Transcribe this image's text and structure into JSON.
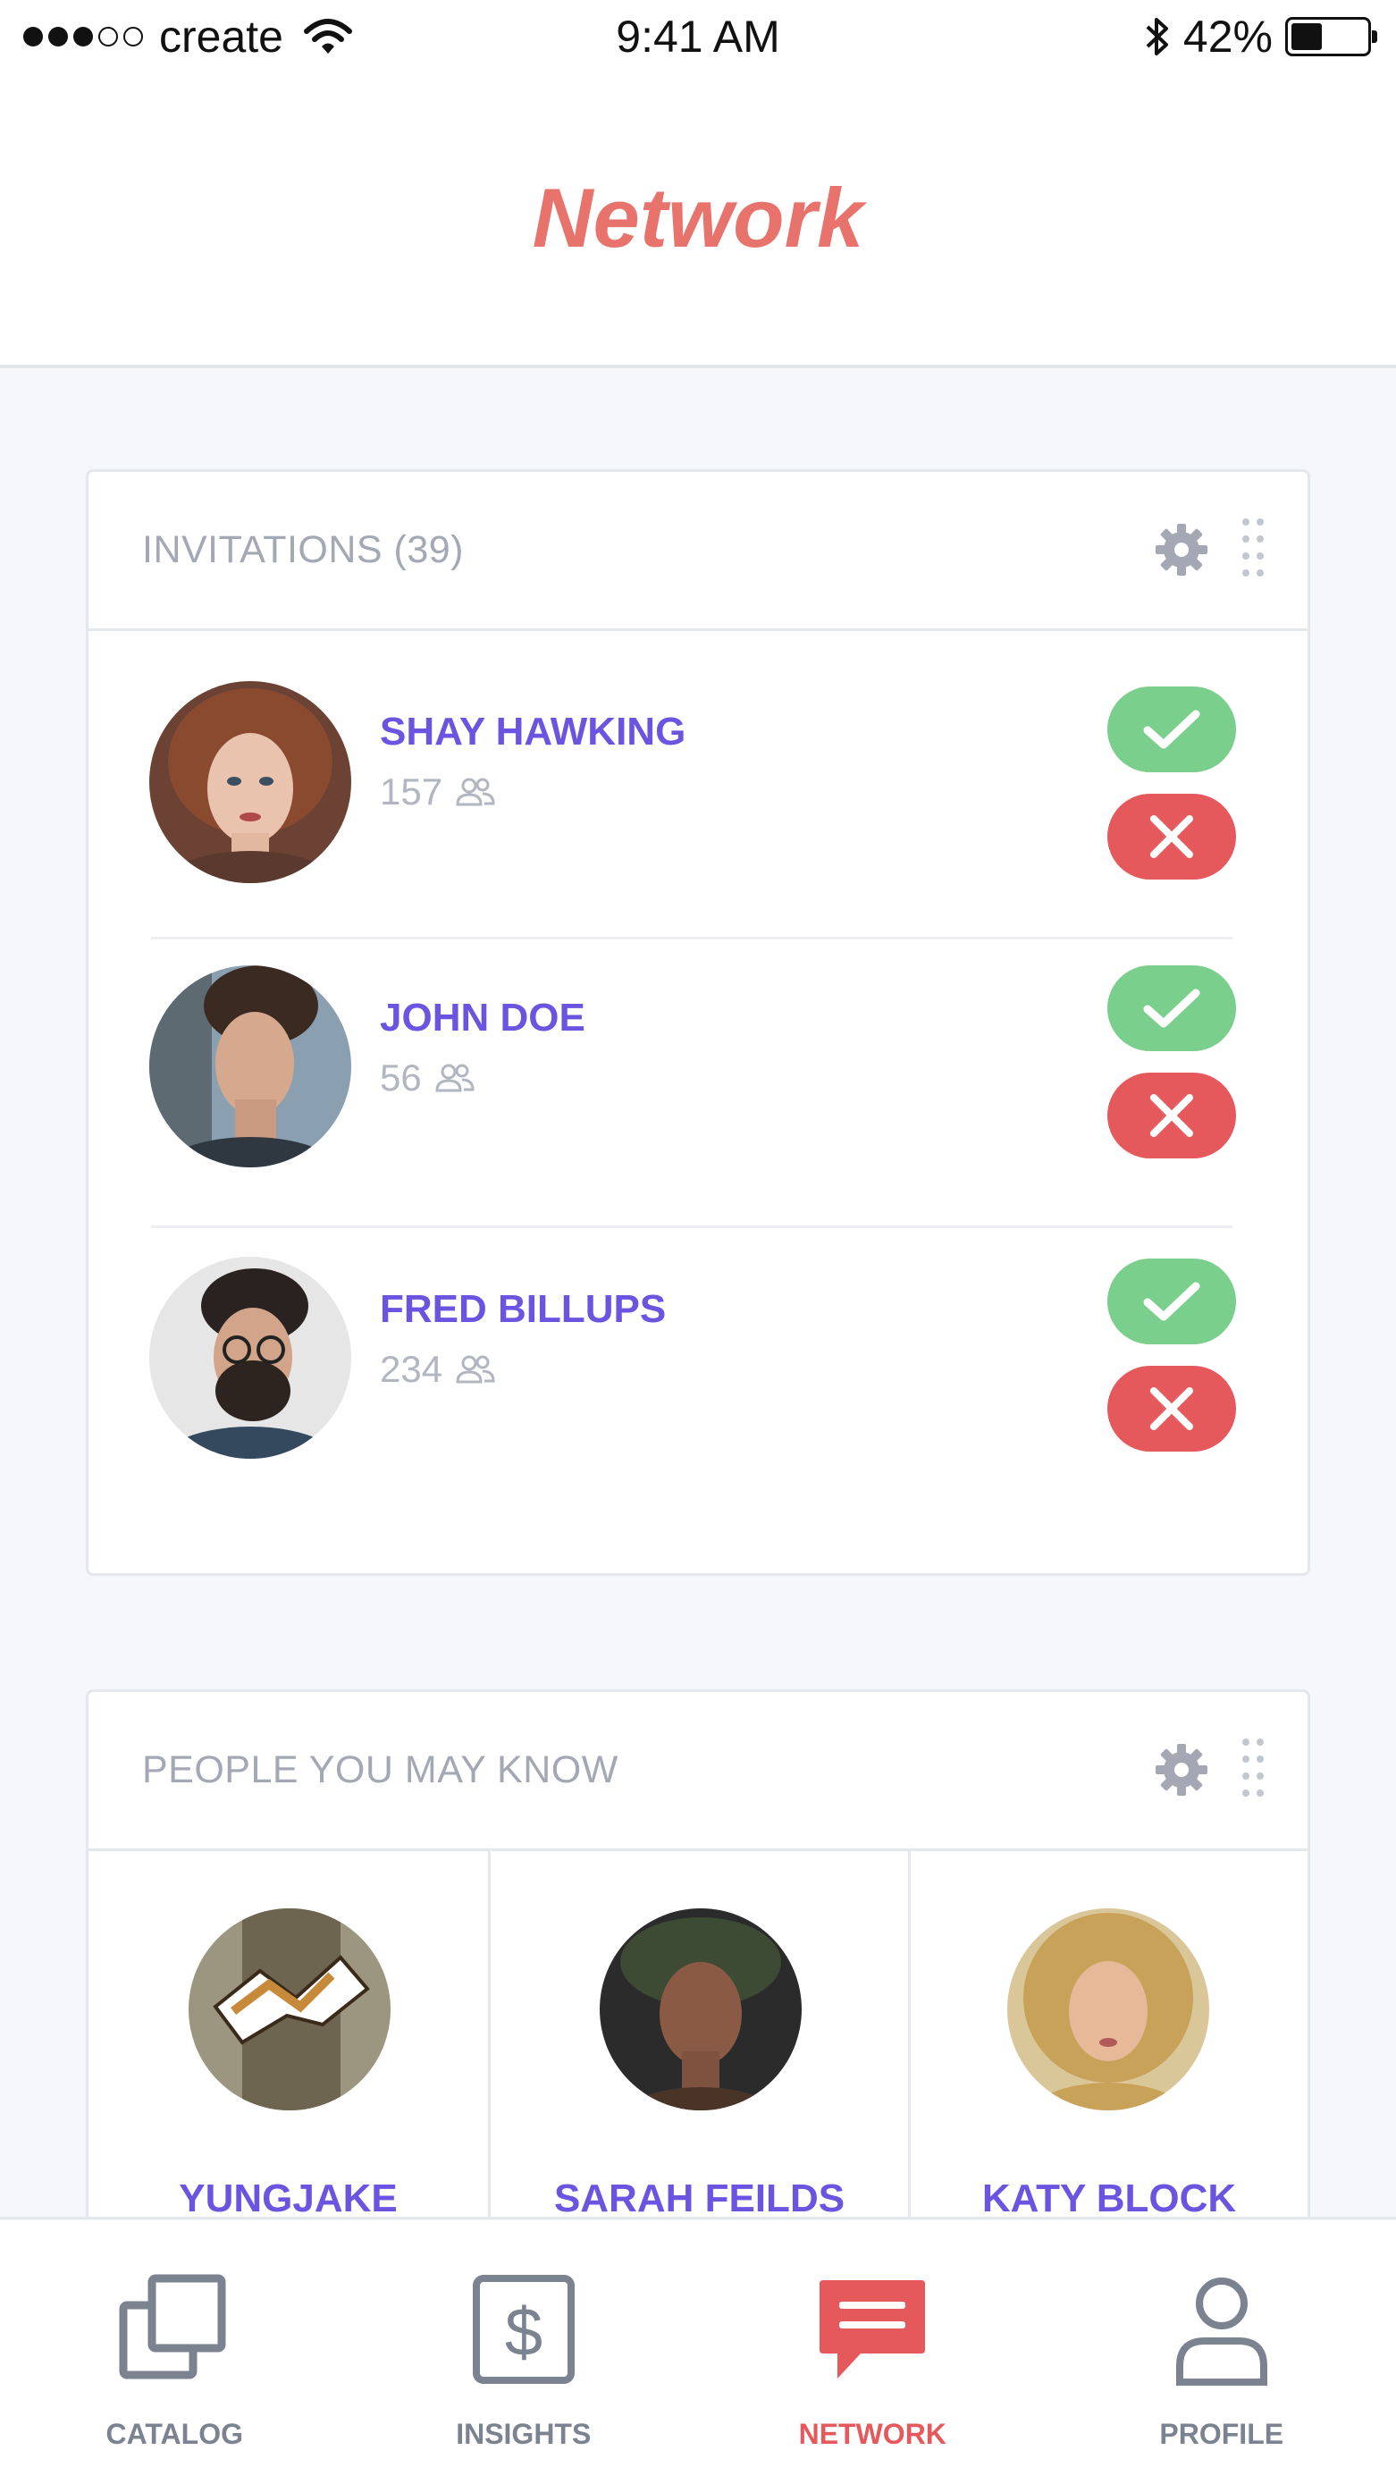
{
  "status_bar": {
    "carrier": "create",
    "time": "9:41 AM",
    "battery": "42%",
    "battery_level": 0.42
  },
  "header": {
    "title": "Network"
  },
  "invitations": {
    "title": "INVITATIONS (39)",
    "items": [
      {
        "name": "SHAY HAWKING",
        "count": "157"
      },
      {
        "name": "JOHN DOE",
        "count": "56"
      },
      {
        "name": "FRED BILLUPS",
        "count": "234"
      }
    ]
  },
  "people": {
    "title": "PEOPLE YOU MAY KNOW",
    "items": [
      {
        "name": "YUNGJAKE"
      },
      {
        "name": "SARAH FEILDS"
      },
      {
        "name": "KATY BLOCK"
      }
    ]
  },
  "tabbar": {
    "tabs": [
      {
        "label": "CATALOG",
        "icon": "catalog-icon"
      },
      {
        "label": "INSIGHTS",
        "icon": "dollar-icon"
      },
      {
        "label": "NETWORK",
        "icon": "chat-icon",
        "active": true
      },
      {
        "label": "PROFILE",
        "icon": "person-icon"
      }
    ]
  },
  "colors": {
    "accent": "#e8736c",
    "name": "#6b55e0",
    "accept": "#7bcf8c",
    "reject": "#e5595c",
    "muted": "#a3a8b4"
  }
}
